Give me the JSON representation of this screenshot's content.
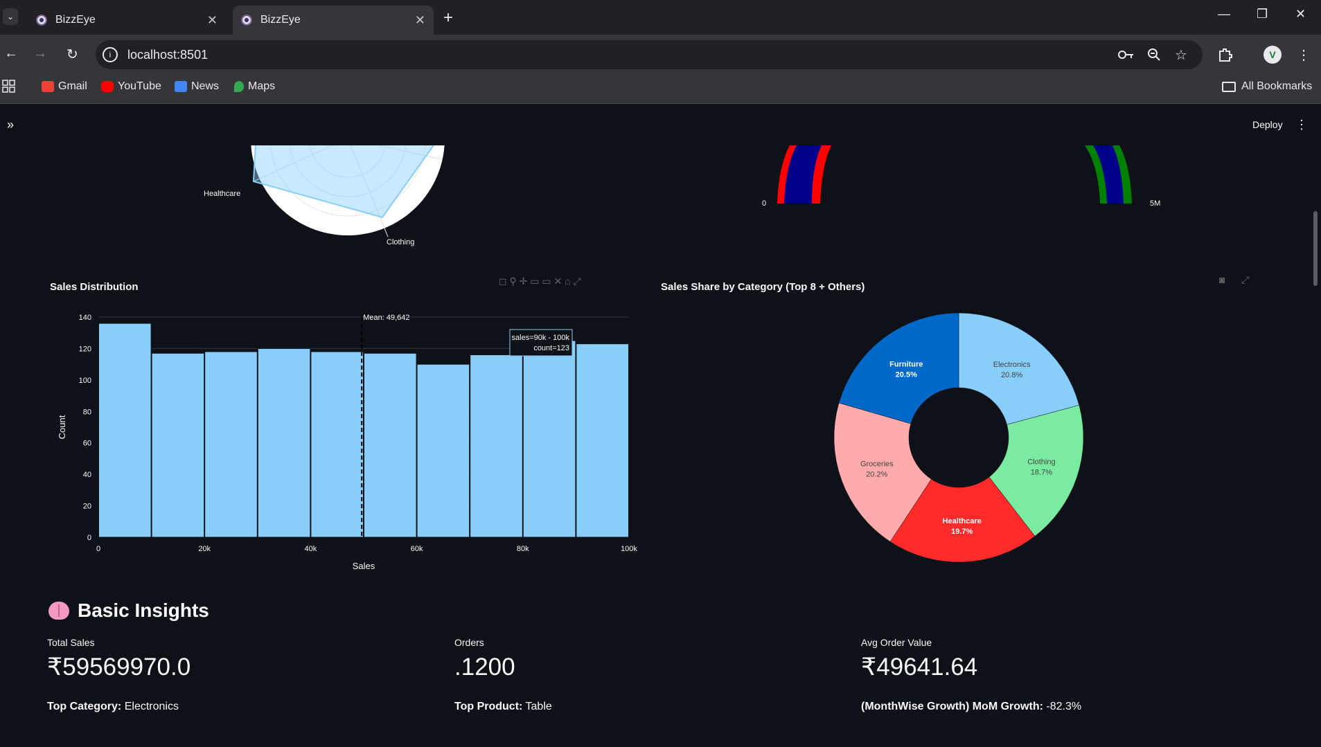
{
  "browser": {
    "tabs": [
      {
        "title": "BizzEye",
        "active": false
      },
      {
        "title": "BizzEye",
        "active": true
      }
    ],
    "url": "localhost:8501",
    "bookmarks": [
      {
        "label": "Gmail",
        "color": "#ea4335"
      },
      {
        "label": "YouTube",
        "color": "#ff0000"
      },
      {
        "label": "News",
        "color": "#4285f4"
      },
      {
        "label": "Maps",
        "color": "#34a853"
      }
    ],
    "all_bookmarks": "All Bookmarks",
    "avatar_letter": "V"
  },
  "app": {
    "deploy_label": "Deploy"
  },
  "radar_labels": {
    "healthcare": "Healthcare",
    "clothing": "Clothing"
  },
  "gauge_labels": {
    "min": "0",
    "max": "5M"
  },
  "histogram": {
    "title": "Sales Distribution",
    "mean_label": "Mean: 49,642",
    "tooltip_line1": "sales=90k - 100k",
    "tooltip_line2": "count=123",
    "xlabel": "Sales",
    "ylabel": "Count"
  },
  "donut": {
    "title": "Sales Share by Category (Top 8 + Others)"
  },
  "chart_data": [
    {
      "type": "bar",
      "title": "Sales Distribution",
      "xlabel": "Sales",
      "ylabel": "Count",
      "x_bins": [
        "0-10k",
        "10k-20k",
        "20k-30k",
        "30k-40k",
        "40k-50k",
        "50k-60k",
        "60k-70k",
        "70k-80k",
        "80k-90k",
        "90k-100k"
      ],
      "values": [
        136,
        117,
        118,
        120,
        118,
        117,
        110,
        116,
        125,
        123
      ],
      "xlim": [
        0,
        100000
      ],
      "ylim": [
        0,
        140
      ],
      "x_ticks": [
        "0",
        "20k",
        "40k",
        "60k",
        "80k",
        "100k"
      ],
      "y_ticks": [
        "0",
        "20",
        "40",
        "60",
        "80",
        "100",
        "120",
        "140"
      ],
      "annotations": [
        "Mean: 49,642"
      ],
      "mean": 49642,
      "bar_color": "#87cefa"
    },
    {
      "type": "pie",
      "title": "Sales Share by Category (Top 8 + Others)",
      "hole": true,
      "slices": [
        {
          "label": "Electronics",
          "percent": "20.8%",
          "value": 20.8,
          "color": "#87cefa"
        },
        {
          "label": "Clothing",
          "percent": "18.7%",
          "value": 18.7,
          "color": "#7aeba0"
        },
        {
          "label": "Healthcare",
          "percent": "19.7%",
          "value": 19.7,
          "color": "#ff2b2b"
        },
        {
          "label": "Groceries",
          "percent": "20.2%",
          "value": 20.2,
          "color": "#ffabab"
        },
        {
          "label": "Furniture",
          "percent": "20.5%",
          "value": 20.5,
          "color": "#0068c9"
        }
      ]
    }
  ],
  "insights": {
    "title": "Basic Insights",
    "metrics": [
      {
        "label": "Total Sales",
        "value": "₹59569970.0"
      },
      {
        "label": "Orders",
        "value": ".1200"
      },
      {
        "label": "Avg Order Value",
        "value": "₹49641.64"
      }
    ],
    "lines": [
      {
        "key": "Top Category:",
        "value": " Electronics"
      },
      {
        "key": "Top Product:",
        "value": " Table"
      },
      {
        "key": "(MonthWise Growth) MoM Growth:",
        "value": " -82.3%"
      }
    ]
  }
}
